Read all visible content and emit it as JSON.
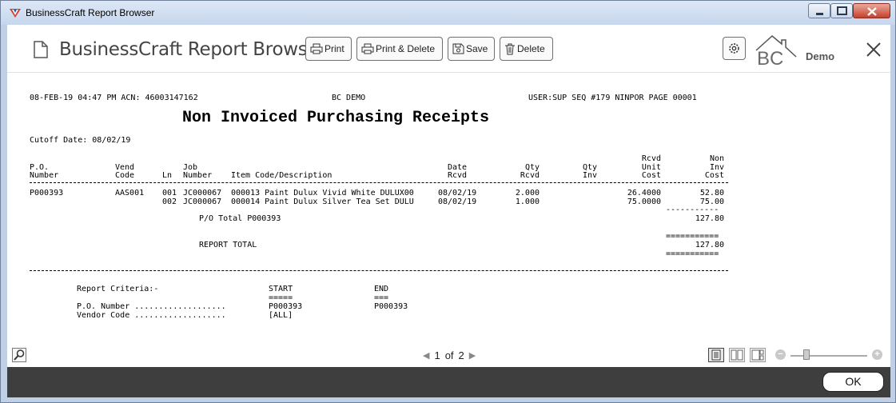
{
  "window": {
    "title": "BusinessCraft Report Browser"
  },
  "header": {
    "title": "BusinessCraft Report Browser",
    "buttons": {
      "print": "Print",
      "print_delete": "Print & Delete",
      "save": "Save",
      "delete": "Delete"
    },
    "logo_text": "BC",
    "company": "Demo"
  },
  "report": {
    "header_left": "08-FEB-19 04:47 PM ACN: 46003147162",
    "header_center": "BC DEMO",
    "header_right": "USER:SUP SEQ #179 NINPOR PAGE 00001",
    "title": "Non Invoiced Purchasing Receipts",
    "cutoff": "Cutoff Date: 08/02/19",
    "columns": {
      "po": [
        "P.O.",
        "Number"
      ],
      "vend": [
        "Vend",
        "Code"
      ],
      "ln": "Ln",
      "job": [
        "Job",
        "Number"
      ],
      "item": "Item Code/Description",
      "date": [
        "Date",
        "Rcvd"
      ],
      "qty_rcvd": [
        "Qty",
        "Rcvd"
      ],
      "qty_inv": [
        "Qty",
        "Inv"
      ],
      "rcvd_unit_cost": [
        "Rcvd",
        "Unit",
        "Cost"
      ],
      "non_inv_cost": [
        "Non",
        "Inv",
        "Cost"
      ]
    },
    "rows": [
      {
        "po": "P000393",
        "vend": "AAS001",
        "ln": "001",
        "job": "JC000067",
        "item": "000013 Paint Dulux Vivid White DULUX00",
        "date": "08/02/19",
        "qty_rcvd": "2.000",
        "unit_cost": "26.4000",
        "non_inv_cost": "52.80"
      },
      {
        "po": "",
        "vend": "",
        "ln": "002",
        "job": "JC000067",
        "item": "000014 Paint Dulux Silver Tea Set DULU",
        "date": "08/02/19",
        "qty_rcvd": "1.000",
        "unit_cost": "75.0000",
        "non_inv_cost": "75.00"
      }
    ],
    "po_total_label": "P/O Total P000393",
    "po_total": "127.80",
    "report_total_label": "REPORT TOTAL",
    "report_total": "127.80",
    "criteria": {
      "label": "Report Criteria:-",
      "start_label": "START",
      "start_underline": "=====",
      "end_label": "END",
      "end_underline": "===",
      "po_label": "P.O. Number ...................",
      "po_start": "P000393",
      "po_end": "P000393",
      "vendor_label": "Vendor Code ...................",
      "vendor_start": "[ALL]"
    },
    "single_rule": "-----------",
    "double_rule": "==========="
  },
  "statusbar": {
    "page_current": "1",
    "page_of": "of",
    "page_total": "2"
  },
  "footer": {
    "ok": "OK"
  }
}
